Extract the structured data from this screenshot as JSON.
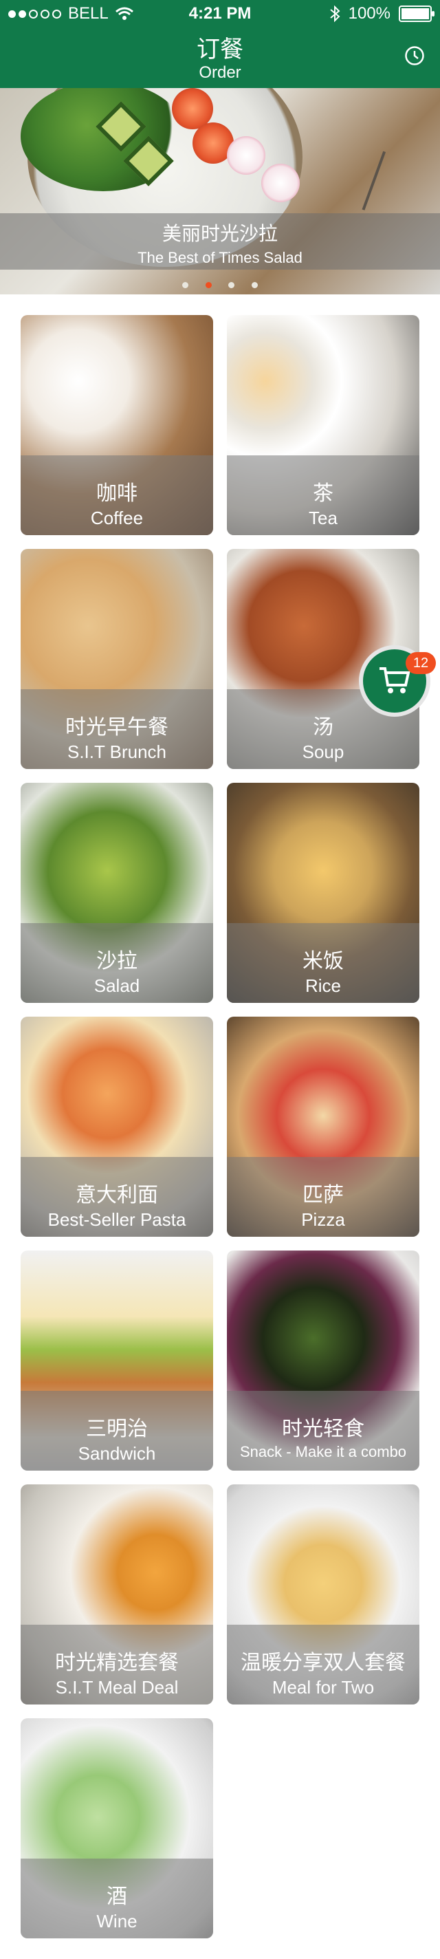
{
  "status_bar": {
    "carrier": "BELL",
    "time": "4:21 PM",
    "battery": "100%",
    "battery_level": 1.0
  },
  "header": {
    "title_cn": "订餐",
    "title_en": "Order"
  },
  "hero": {
    "title_cn": "美丽时光沙拉",
    "title_en": "The Best of Times Salad",
    "pager_count": 4,
    "pager_active": 1
  },
  "menu": [
    {
      "cn": "咖啡",
      "en": "Coffee"
    },
    {
      "cn": "茶",
      "en": "Tea"
    },
    {
      "cn": "时光早午餐",
      "en": "S.I.T Brunch"
    },
    {
      "cn": "汤",
      "en": "Soup"
    },
    {
      "cn": "沙拉",
      "en": "Salad"
    },
    {
      "cn": "米饭",
      "en": "Rice"
    },
    {
      "cn": "意大利面",
      "en": "Best-Seller Pasta"
    },
    {
      "cn": "匹萨",
      "en": "Pizza"
    },
    {
      "cn": "三明治",
      "en": "Sandwich"
    },
    {
      "cn": "时光轻食",
      "en": "Snack - Make it a combo"
    },
    {
      "cn": "时光精选套餐",
      "en": "S.I.T Meal Deal"
    },
    {
      "cn": "温暖分享双人套餐",
      "en": "Meal for Two"
    },
    {
      "cn": "酒",
      "en": "Wine"
    }
  ],
  "cart": {
    "count": "12"
  },
  "colors": {
    "brand_green": "#117a4a",
    "accent_orange": "#f04e1f"
  }
}
